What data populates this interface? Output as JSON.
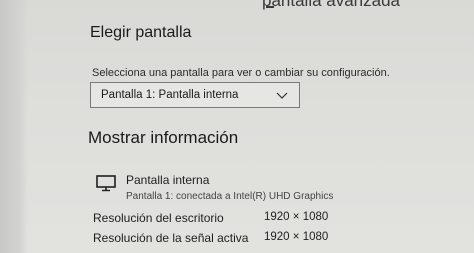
{
  "header": {
    "title_cut": "pantalla avanzada"
  },
  "display_select": {
    "title": "Elegir pantalla",
    "description": "Selecciona una pantalla para ver o cambiar su configuración.",
    "selected_value": "Pantalla 1: Pantalla interna"
  },
  "info": {
    "title": "Mostrar información",
    "display_name": "Pantalla interna",
    "display_subtitle": "Pantalla 1: conectada a Intel(R) UHD Graphics",
    "rows": [
      {
        "label": "Resolución del escritorio",
        "value": "1920 × 1080"
      },
      {
        "label": "Resolución de la señal activa",
        "value": "1920 × 1080"
      },
      {
        "label": "",
        "value": ""
      }
    ]
  },
  "icons": {
    "monitor": "monitor-icon",
    "chevron": "chevron-down-icon"
  }
}
